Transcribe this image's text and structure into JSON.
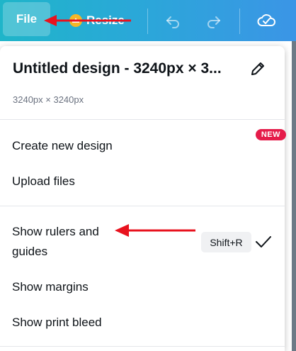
{
  "toolbar": {
    "file_label": "File",
    "resize_label": "Resize",
    "colors": {
      "accent_start": "#1fb5c9",
      "accent_end": "#3b95e6"
    }
  },
  "panel": {
    "title": "Untitled design - 3240px × 3...",
    "subtitle": "3240px × 3240px",
    "items": [
      {
        "label": "Create new design"
      },
      {
        "label": "Upload files",
        "badge": "NEW"
      },
      {
        "label_line1": "Show rulers and",
        "label_line2": "guides",
        "shortcut": "Shift+R",
        "checked": true
      },
      {
        "label": "Show margins"
      },
      {
        "label": "Show print bleed"
      }
    ]
  },
  "icons": [
    "crown-icon",
    "undo-icon",
    "redo-icon",
    "cloud-check-icon",
    "pencil-icon",
    "check-icon"
  ],
  "annotations": {
    "arrow_color": "#e8121e"
  }
}
